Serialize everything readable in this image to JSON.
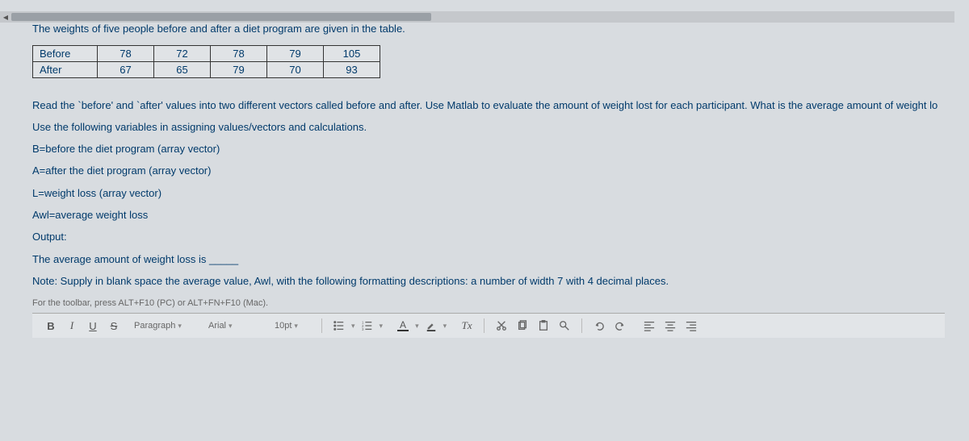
{
  "intro": "The weights of five people before and after a diet program are given in the table.",
  "table": {
    "rows": [
      {
        "label": "Before",
        "values": [
          "78",
          "72",
          "78",
          "79",
          "105"
        ]
      },
      {
        "label": "After",
        "values": [
          "67",
          "65",
          "79",
          "70",
          "93"
        ]
      }
    ]
  },
  "instructions": [
    "Read the `before' and `after' values into two different vectors called before and after. Use Matlab to evaluate the amount of weight lost for each participant. What is the average amount of weight lo",
    "Use the following variables in assigning values/vectors and calculations.",
    "B=before the diet program (array vector)",
    "A=after the diet program (array vector)",
    "L=weight loss (array vector)",
    "Awl=average weight loss",
    "Output:",
    "The average amount of weight loss is _____",
    "Note: Supply in blank space the average value, Awl, with the following formatting descriptions: a number of width 7 with 4 decimal places."
  ],
  "toolbarHint": "For the toolbar, press ALT+F10 (PC) or ALT+FN+F10 (Mac).",
  "toolbar": {
    "bold": "B",
    "italic": "I",
    "underline": "U",
    "strike": "S",
    "paragraph": "Paragraph",
    "font": "Arial",
    "size": "10pt",
    "textColor": "A",
    "clearFormat": "Tx"
  }
}
